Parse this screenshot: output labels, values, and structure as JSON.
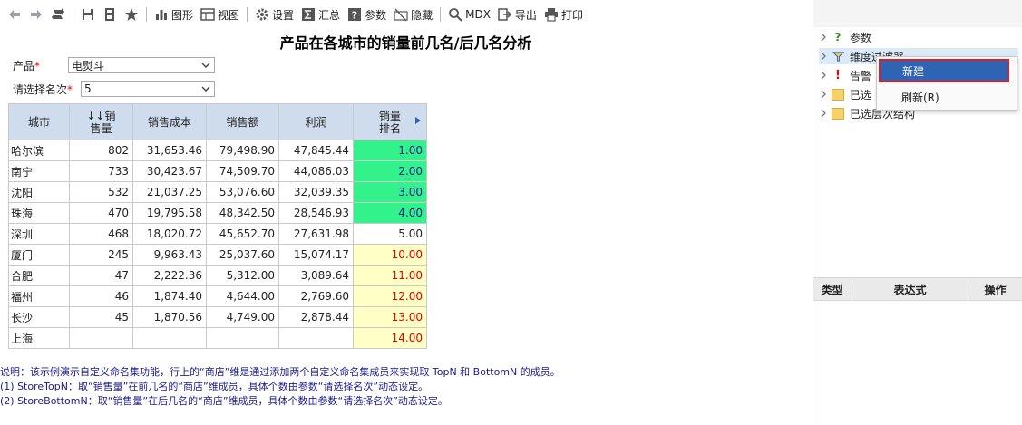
{
  "toolbar": {
    "chart_label": "图形",
    "view_label": "视图",
    "settings_label": "设置",
    "summary_label": "汇总",
    "param_label": "参数",
    "hide_label": "隐藏",
    "mdx_label": "MDX",
    "export_label": "导出",
    "print_label": "打印"
  },
  "report": {
    "title": "产品在各城市的销量前几名/后几名分析",
    "params": [
      {
        "label": "产品",
        "required": "*",
        "value": "电熨斗"
      },
      {
        "label": "请选择名次",
        "required": "*",
        "value": "5"
      }
    ]
  },
  "table": {
    "headers": [
      "城市",
      "↓↓销售量",
      "销售成本",
      "销售额",
      "利润",
      "销量排名"
    ],
    "rows": [
      {
        "city": "哈尔滨",
        "qty": "802",
        "cost": "31,653.46",
        "sales": "79,498.90",
        "profit": "47,845.44",
        "rank": "1.00",
        "style": "green"
      },
      {
        "city": "南宁",
        "qty": "733",
        "cost": "30,423.67",
        "sales": "74,509.70",
        "profit": "44,086.03",
        "rank": "2.00",
        "style": "green"
      },
      {
        "city": "沈阳",
        "qty": "532",
        "cost": "21,037.25",
        "sales": "53,076.60",
        "profit": "32,039.35",
        "rank": "3.00",
        "style": "green"
      },
      {
        "city": "珠海",
        "qty": "470",
        "cost": "19,795.58",
        "sales": "48,342.50",
        "profit": "28,546.93",
        "rank": "4.00",
        "style": "green"
      },
      {
        "city": "深圳",
        "qty": "468",
        "cost": "18,020.72",
        "sales": "45,652.70",
        "profit": "27,631.98",
        "rank": "5.00",
        "style": "plain"
      },
      {
        "city": "厦门",
        "qty": "245",
        "cost": "9,963.43",
        "sales": "25,037.60",
        "profit": "15,074.17",
        "rank": "10.00",
        "style": "yellow"
      },
      {
        "city": "合肥",
        "qty": "47",
        "cost": "2,222.36",
        "sales": "5,312.00",
        "profit": "3,089.64",
        "rank": "11.00",
        "style": "yellow"
      },
      {
        "city": "福州",
        "qty": "46",
        "cost": "1,874.40",
        "sales": "4,644.00",
        "profit": "2,769.60",
        "rank": "12.00",
        "style": "yellow"
      },
      {
        "city": "长沙",
        "qty": "45",
        "cost": "1,870.56",
        "sales": "4,749.00",
        "profit": "2,878.44",
        "rank": "13.00",
        "style": "yellow"
      },
      {
        "city": "上海",
        "qty": "",
        "cost": "",
        "sales": "",
        "profit": "",
        "rank": "14.00",
        "style": "yellow"
      }
    ]
  },
  "notes": [
    "说明：该示例演示自定义命名集功能，行上的“商店”维是通过添加两个自定义命名集成员来实现取 TopN 和 BottomN 的成员。",
    " (1) StoreTopN：取“销售量”在前几名的“商店”维成员，具体个数由参数“请选择名次”动态设定。",
    " (2) StoreBottomN：取“销售量”在后几名的“商店”维成员，具体个数由参数“请选择名次”动态设定。"
  ],
  "panel": {
    "tree": [
      {
        "label": "参数",
        "icon": "question-icon"
      },
      {
        "label": "维度过滤器",
        "icon": "filter-icon"
      },
      {
        "label": "告警",
        "icon": "warning-icon"
      },
      {
        "label": "已选",
        "icon": "folder-icon"
      },
      {
        "label": "已选层次结构",
        "icon": "folder-icon"
      }
    ],
    "context_menu": {
      "new_label": "新建",
      "refresh_label": "刷新(R)"
    },
    "expr_header": [
      "类型",
      "表达式",
      "操作"
    ]
  },
  "colors": {
    "header_bg": "#cfdcee",
    "top_rank_bg": "#33f28b",
    "bottom_rank_bg": "#ffffc6",
    "bottom_rank_text": "#e00000",
    "menu_highlight": "#2f64b5",
    "note_text": "#1c1c8c"
  }
}
